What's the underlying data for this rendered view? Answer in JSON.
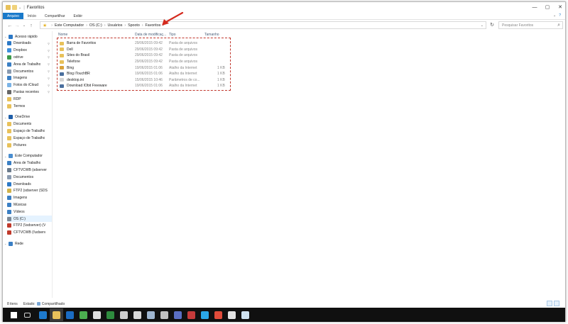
{
  "window": {
    "title": "Favoritos",
    "title_sep": "|",
    "qat_icons": [
      "properties-icon",
      "new-folder-icon",
      "dropdown-icon"
    ],
    "controls": [
      "—",
      "▢",
      "✕"
    ]
  },
  "ribbon": {
    "tabs": [
      {
        "label": "Arquivo",
        "active": true
      },
      {
        "label": "Início",
        "active": false
      },
      {
        "label": "Compartilhar",
        "active": false
      },
      {
        "label": "Exibir",
        "active": false
      }
    ],
    "expand_icon": "⌄",
    "help_icon": "?"
  },
  "address": {
    "back": "←",
    "forward": "→",
    "recent": "⌄",
    "up": "↑",
    "crumbs": [
      "Este Computador",
      "OS (C:)",
      "Usuários",
      "Spooto",
      "Favoritos"
    ],
    "crumb_sep": "›",
    "refresh": "↻",
    "search_placeholder": "Pesquisar Favoritos",
    "search_icon": "⌕"
  },
  "nav": {
    "items": [
      {
        "label": "Acesso rápido",
        "icon": "star-icon",
        "color": "#2b78c6",
        "level": 0
      },
      {
        "label": "Downloads",
        "icon": "downloads-icon",
        "color": "#2b78c6",
        "level": 1,
        "pinned": true
      },
      {
        "label": "Dropbox",
        "icon": "dropbox-icon",
        "color": "#3d8fdc",
        "level": 1,
        "pinned": true
      },
      {
        "label": "odrive",
        "icon": "odrive-icon",
        "color": "#3c9a4a",
        "level": 1,
        "pinned": true
      },
      {
        "label": "Área de Trabalho",
        "icon": "desktop-icon",
        "color": "#3a7fc4",
        "level": 1,
        "pinned": true
      },
      {
        "label": "Documentos",
        "icon": "documents-icon",
        "color": "#8a9bb0",
        "level": 1,
        "pinned": true
      },
      {
        "label": "Imagens",
        "icon": "pictures-icon",
        "color": "#3a7fc4",
        "level": 1,
        "pinned": true
      },
      {
        "label": "Fotos do iCloud",
        "icon": "icloud-icon",
        "color": "#7ab3e6",
        "level": 1,
        "pinned": true
      },
      {
        "label": "Pastas recentes",
        "icon": "recent-folders-icon",
        "color": "#666666",
        "level": 1,
        "pinned": true
      },
      {
        "label": "RDP",
        "icon": "folder-icon",
        "color": "#e8c15a",
        "level": 1
      },
      {
        "label": "Termos",
        "icon": "folder-icon",
        "color": "#e8c15a",
        "level": 1
      },
      {
        "label": "OneDrive",
        "icon": "onedrive-icon",
        "color": "#1f5ea8",
        "level": 0
      },
      {
        "label": "Documents",
        "icon": "folder-icon",
        "color": "#e8c15a",
        "level": 1
      },
      {
        "label": "Espaço de Trabalho",
        "icon": "folder-icon",
        "color": "#e8c15a",
        "level": 1
      },
      {
        "label": "Espaço de Trabalho",
        "icon": "folder-icon",
        "color": "#e8c15a",
        "level": 1
      },
      {
        "label": "Pictures",
        "icon": "folder-icon",
        "color": "#e8c15a",
        "level": 1
      },
      {
        "label": "Este Computador",
        "icon": "computer-icon",
        "color": "#4a8ed0",
        "level": 0
      },
      {
        "label": "Área de Trabalho",
        "icon": "desktop-icon",
        "color": "#3a7fc4",
        "level": 1
      },
      {
        "label": "CFTVCWB (sdserver",
        "icon": "network-drive-icon",
        "color": "#6b7b8c",
        "level": 1
      },
      {
        "label": "Documentos",
        "icon": "documents-icon",
        "color": "#8a9bb0",
        "level": 1
      },
      {
        "label": "Downloads",
        "icon": "downloads-icon",
        "color": "#2b78c6",
        "level": 1
      },
      {
        "label": "FTP2 (sdserver (SDS",
        "icon": "network-drive-icon",
        "color": "#d1b34a",
        "level": 1
      },
      {
        "label": "Imagens",
        "icon": "pictures-icon",
        "color": "#3a7fc4",
        "level": 1
      },
      {
        "label": "Músicas",
        "icon": "music-icon",
        "color": "#3a7fc4",
        "level": 1
      },
      {
        "label": "Vídeos",
        "icon": "videos-icon",
        "color": "#3a7fc4",
        "level": 1
      },
      {
        "label": "OS (C:)",
        "icon": "drive-icon",
        "color": "#7b8896",
        "level": 1,
        "selected": true
      },
      {
        "label": "FTP2 (\\\\sdserver) (V",
        "icon": "network-drive-icon",
        "color": "#c0392b",
        "level": 1
      },
      {
        "label": "CFTVCWB (\\\\sdserv",
        "icon": "network-drive-icon",
        "color": "#c0392b",
        "level": 1
      },
      {
        "label": "Rede",
        "icon": "network-icon",
        "color": "#3a7fc4",
        "level": 0
      }
    ]
  },
  "list": {
    "headers": {
      "name": "Nome",
      "date": "Data de modificaç...",
      "type": "Tipo",
      "size": "Tamanho"
    },
    "rows": [
      {
        "name": "Barra de Favoritos",
        "date": "29/06/2015 09:42",
        "type": "Pasta de arquivos",
        "size": "",
        "icon": "folder-icon",
        "color": "#e8c15a"
      },
      {
        "name": "Dell",
        "date": "29/06/2015 09:42",
        "type": "Pasta de arquivos",
        "size": "",
        "icon": "folder-icon",
        "color": "#e8c15a"
      },
      {
        "name": "Sites do Brasil",
        "date": "29/06/2015 09:42",
        "type": "Pasta de arquivos",
        "size": "",
        "icon": "folder-icon",
        "color": "#e8c15a"
      },
      {
        "name": "Telefone",
        "date": "29/06/2015 09:42",
        "type": "Pasta de arquivos",
        "size": "",
        "icon": "folder-icon",
        "color": "#e8c15a"
      },
      {
        "name": "Bing",
        "date": "19/06/2015 01:06",
        "type": "Atalho da Internet",
        "size": "1 KB",
        "icon": "bing-shortcut-icon",
        "color": "#d9a23a"
      },
      {
        "name": "Blog iTouchBR",
        "date": "19/06/2015 01:06",
        "type": "Atalho da Internet",
        "size": "1 KB",
        "icon": "internet-shortcut-icon",
        "color": "#4a6f9e"
      },
      {
        "name": "desktop.ini",
        "date": "15/06/2015 10:46",
        "type": "Parâmetros de co...",
        "size": "1 KB",
        "icon": "settings-file-icon",
        "color": "#d4d4d4"
      },
      {
        "name": "Download IObit Freeware",
        "date": "19/06/2015 01:06",
        "type": "Atalho da Internet",
        "size": "1 KB",
        "icon": "internet-shortcut-icon",
        "color": "#4a6f9e"
      }
    ]
  },
  "status": {
    "count": "8 itens",
    "state_label": "Estado:",
    "state_value": "Compartilhado"
  },
  "taskbar": {
    "items": [
      {
        "icon": "start-icon",
        "color": "#ffffff"
      },
      {
        "icon": "task-view-icon",
        "color": "#d0d0d0"
      },
      {
        "icon": "outlook-icon",
        "color": "#1e7acd"
      },
      {
        "icon": "file-explorer-icon",
        "color": "#e8c15a",
        "active": true
      },
      {
        "icon": "outlook-app-icon",
        "color": "#1b6cc3"
      },
      {
        "icon": "chrome-icon",
        "color": "#4caf50"
      },
      {
        "icon": "word-icon",
        "color": "#e0e0e0"
      },
      {
        "icon": "excel-icon",
        "color": "#2e8b3e"
      },
      {
        "icon": "terminal-icon",
        "color": "#cfcfcf"
      },
      {
        "icon": "network-app-icon",
        "color": "#d8d8d8"
      },
      {
        "icon": "remote-desktop-icon",
        "color": "#9fb6d0"
      },
      {
        "icon": "tools-icon",
        "color": "#c0c0c0"
      },
      {
        "icon": "teams-icon",
        "color": "#5b6fc4"
      },
      {
        "icon": "notes-icon",
        "color": "#c63b3b"
      },
      {
        "icon": "skype-icon",
        "color": "#2aa7e8"
      },
      {
        "icon": "chrome-icon",
        "color": "#e04b3a"
      },
      {
        "icon": "messenger-icon",
        "color": "#e3e3e3"
      },
      {
        "icon": "chat-icon",
        "color": "#cfe2f1"
      }
    ]
  },
  "annotation": {
    "color": "#d42a1e"
  }
}
